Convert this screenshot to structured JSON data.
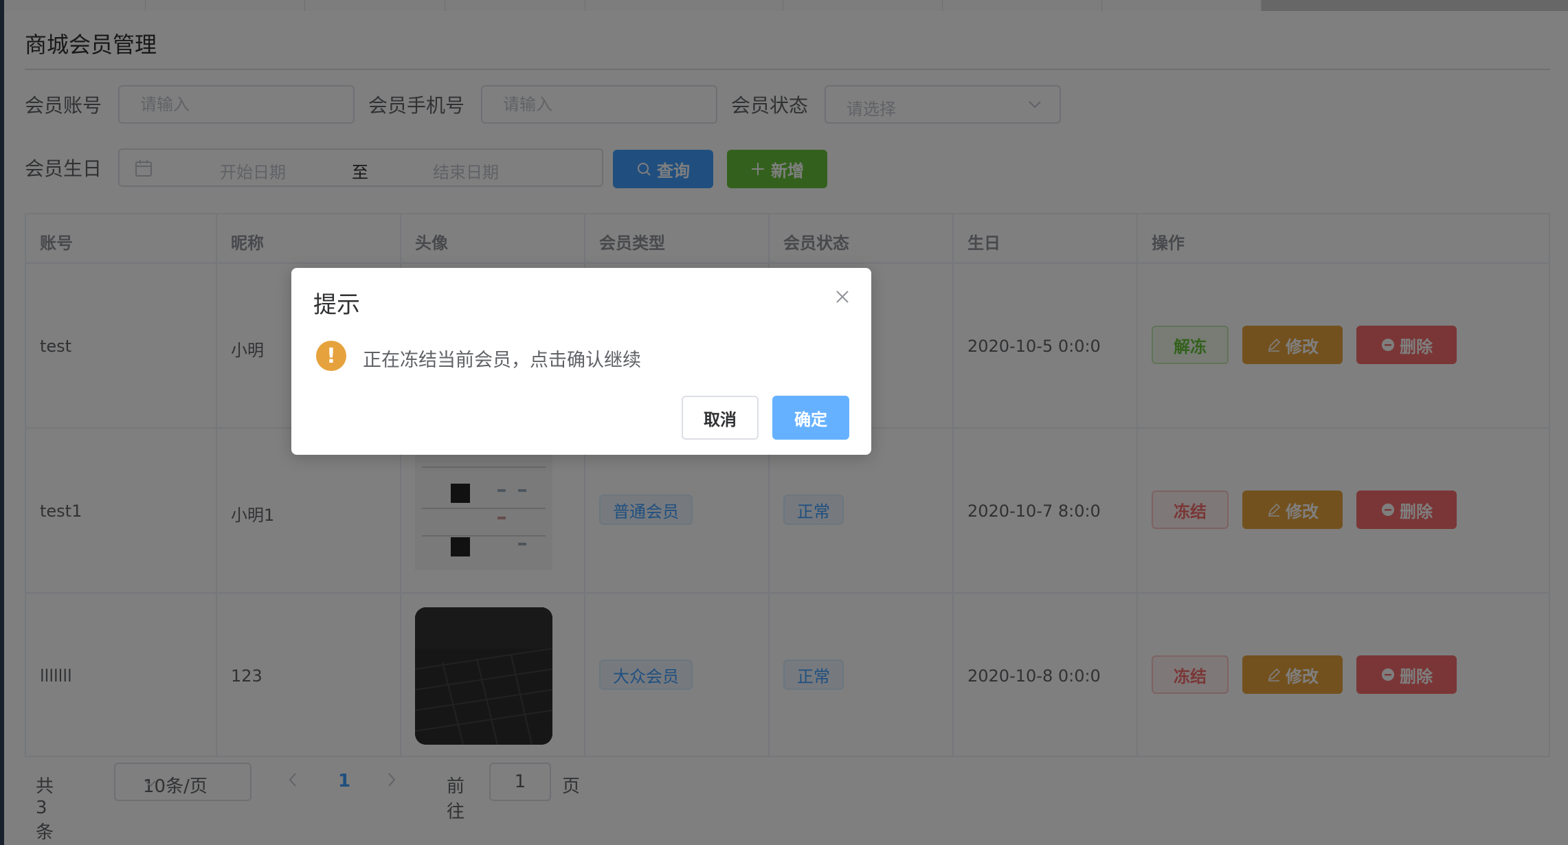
{
  "page": {
    "title": "商城会员管理"
  },
  "filters": {
    "account_label": "会员账号",
    "account_placeholder": "请输入",
    "phone_label": "会员手机号",
    "phone_placeholder": "请输入",
    "status_label": "会员状态",
    "status_placeholder": "请选择",
    "birthday_label": "会员生日",
    "start_placeholder": "开始日期",
    "range_separator": "至",
    "end_placeholder": "结束日期",
    "search_label": "查询",
    "add_label": "新增"
  },
  "table": {
    "columns": [
      "账号",
      "昵称",
      "头像",
      "会员类型",
      "会员状态",
      "生日",
      "操作"
    ],
    "rows": [
      {
        "account": "test",
        "nickname": "小明",
        "type": "",
        "status": "",
        "birthday": "2020-10-5 0:0:0",
        "toggle_label": "解冻",
        "toggle_kind": "unfreeze"
      },
      {
        "account": "test1",
        "nickname": "小明1",
        "type": "普通会员",
        "status": "正常",
        "birthday": "2020-10-7 8:0:0",
        "toggle_label": "冻结",
        "toggle_kind": "freeze"
      },
      {
        "account": "lllllll",
        "nickname": "123",
        "type": "大众会员",
        "status": "正常",
        "birthday": "2020-10-8 0:0:0",
        "toggle_label": "冻结",
        "toggle_kind": "freeze"
      }
    ],
    "edit_label": "修改",
    "delete_label": "删除"
  },
  "pagination": {
    "total": "共 3 条",
    "page_size": "10条/页",
    "current_page": "1",
    "goto_label": "前往",
    "goto_value": "1",
    "page_suffix": "页"
  },
  "dialog": {
    "title": "提示",
    "message": "正在冻结当前会员，点击确认继续",
    "cancel_label": "取消",
    "confirm_label": "确定"
  },
  "colors": {
    "primary": "#409eff",
    "success": "#67c23a",
    "warning": "#e6a23c",
    "danger": "#f56c6c"
  }
}
